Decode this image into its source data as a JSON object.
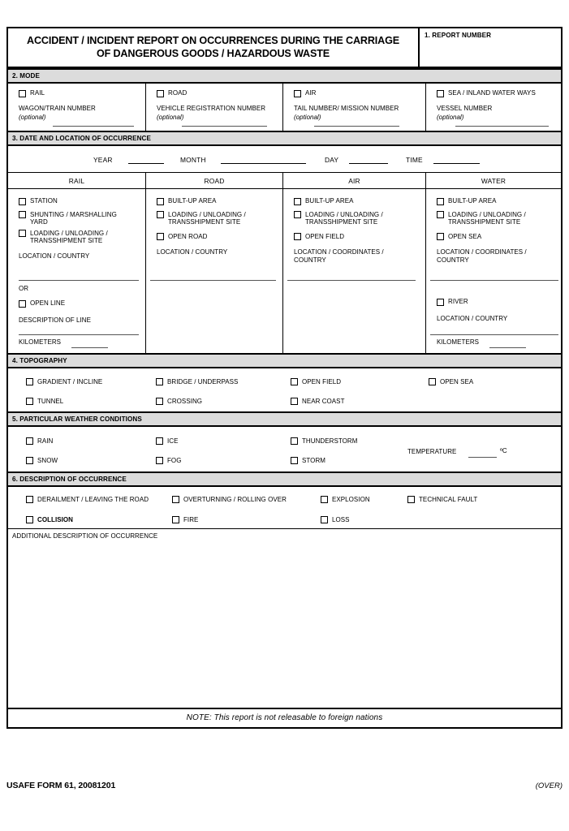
{
  "form": {
    "title_line1": "ACCIDENT / INCIDENT REPORT ON OCCURRENCES DURING THE CARRIAGE",
    "title_line2": "OF DANGEROUS GOODS / HAZARDOUS WASTE",
    "report_number_label": "1.  REPORT NUMBER",
    "report_number_value": ""
  },
  "sections": {
    "mode": "2.  MODE",
    "date_location": "3.  DATE AND LOCATION OF OCCURRENCE",
    "topography": "4.  TOPOGRAPHY",
    "weather": "5.  PARTICULAR WEATHER CONDITIONS",
    "description": "6.  DESCRIPTION OF OCCURRENCE"
  },
  "mode": {
    "columns": [
      {
        "checkbox_label": "RAIL",
        "field_label": "WAGON/TRAIN NUMBER",
        "optional": "(optional)",
        "value": ""
      },
      {
        "checkbox_label": "ROAD",
        "field_label": "VEHICLE REGISTRATION NUMBER",
        "optional": "(optional)",
        "value": ""
      },
      {
        "checkbox_label": "AIR",
        "field_label": "TAIL NUMBER/ MISSION NUMBER",
        "optional": "(optional)",
        "value": ""
      },
      {
        "checkbox_label": "SEA / INLAND WATER WAYS",
        "field_label": "VESSEL NUMBER",
        "optional": "(optional)",
        "value": ""
      }
    ]
  },
  "datetime": {
    "year_label": "YEAR",
    "year_value": "",
    "month_label": "MONTH",
    "month_value": "",
    "day_label": "DAY",
    "day_value": "",
    "time_label": "TIME",
    "time_value": ""
  },
  "location": {
    "headers": [
      "RAIL",
      "ROAD",
      "AIR",
      "WATER"
    ],
    "rail": {
      "options": [
        "STATION",
        "SHUNTING / MARSHALLING YARD",
        "LOADING / UNLOADING / TRANSSHIPMENT SITE"
      ],
      "location_label": "LOCATION / COUNTRY",
      "location_value": "",
      "or_label": "OR",
      "open_line_label": "OPEN LINE",
      "description_label": "DESCRIPTION OF LINE",
      "description_value": "",
      "kilometers_label": "KILOMETERS",
      "kilometers_value": ""
    },
    "road": {
      "options": [
        "BUILT-UP AREA",
        "LOADING / UNLOADING / TRANSSHIPMENT SITE",
        "OPEN ROAD"
      ],
      "location_label": "LOCATION / COUNTRY",
      "location_value": ""
    },
    "air": {
      "options": [
        "BUILT-UP AREA",
        "LOADING / UNLOADING / TRANSSHIPMENT SITE",
        "OPEN FIELD"
      ],
      "location_label": "LOCATION / COORDINATES / COUNTRY",
      "location_value": ""
    },
    "water": {
      "options": [
        "BUILT-UP AREA",
        "LOADING / UNLOADING / TRANSSHIPMENT SITE",
        "OPEN SEA"
      ],
      "location_label": "LOCATION / COORDINATES / COUNTRY",
      "location_value": "",
      "river_label": "RIVER",
      "river_location_label": "LOCATION / COUNTRY",
      "river_location_value": "",
      "kilometers_label": "KILOMETERS",
      "kilometers_value": ""
    }
  },
  "topography": {
    "row1": [
      "GRADIENT / INCLINE",
      "BRIDGE / UNDERPASS",
      "OPEN FIELD",
      "OPEN SEA"
    ],
    "row2": [
      "TUNNEL",
      "CROSSING",
      "NEAR COAST"
    ]
  },
  "weather": {
    "row1": [
      "RAIN",
      "ICE",
      "THUNDERSTORM"
    ],
    "row2": [
      "SNOW",
      "FOG",
      "STORM"
    ],
    "temperature_label": "TEMPERATURE",
    "temperature_value": "",
    "temperature_unit": "ºC"
  },
  "occurrence": {
    "row1": [
      "DERAILMENT / LEAVING THE ROAD",
      "OVERTURNING / ROLLING OVER",
      "EXPLOSION",
      "TECHNICAL FAULT"
    ],
    "row2": [
      "COLLISION",
      "FIRE",
      "LOSS"
    ],
    "additional_label": "ADDITIONAL DESCRIPTION OF OCCURRENCE",
    "additional_value": ""
  },
  "note": "NOTE:  This report is not releasable to foreign nations",
  "footer": {
    "form_id": "USAFE FORM 61, 20081201",
    "over": "(OVER)"
  }
}
